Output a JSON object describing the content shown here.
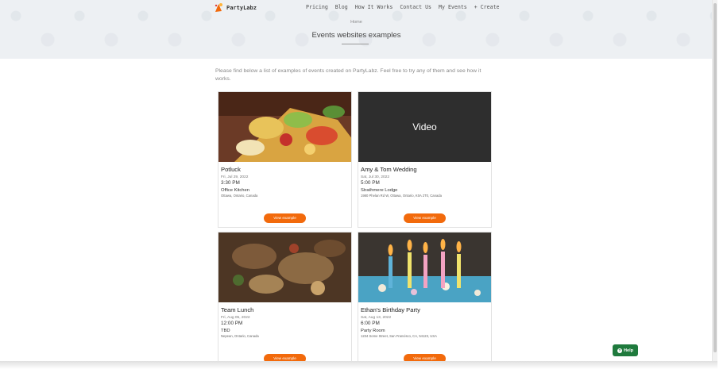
{
  "header": {
    "logo_text": "PartyLabz",
    "nav": [
      "Pricing",
      "Blog",
      "How It Works",
      "Contact Us",
      "My Events",
      "+ Create"
    ]
  },
  "breadcrumb": "Home",
  "page_title": "Events websites examples",
  "intro": "Please find below a list of examples of events created on PartyLabz. Feel free to try any of them and see how it works.",
  "cards": [
    {
      "name": "Potluck",
      "date": "Fri, Jul 29, 2022",
      "time": "3:30 PM",
      "venue": "Office Kitchen",
      "address": "Ottawa, Ontario, Canada",
      "button": "View example",
      "media": "food-platter-photo"
    },
    {
      "name": "Amy & Tom Wedding",
      "date": "Sat, Jul 30, 2022",
      "time": "5:00 PM",
      "venue": "Strathmere Lodge",
      "address": "1980 Phelan Rd W, Ottawa, Ontario, K0A 2T0, Canada",
      "button": "View example",
      "media_label": "Video"
    },
    {
      "name": "Team Lunch",
      "date": "Fri, Aug 05, 2022",
      "time": "12:00 PM",
      "venue": "TBD",
      "address": "Nepean, Ontario, Canada",
      "button": "View example",
      "media": "lunch-table-photo"
    },
    {
      "name": "Ethan's Birthday Party",
      "date": "Sat, Aug 13, 2022",
      "time": "6:00 PM",
      "venue": "Party Room",
      "address": "1234 Some Street, San Francisco, CA, 54123, USA",
      "button": "View example",
      "media": "birthday-candles-photo"
    }
  ],
  "help": {
    "label": "Help",
    "icon": "question-circle-icon"
  },
  "colors": {
    "accent": "#f26a0c",
    "help": "#1f7a3d",
    "video_bg": "#2e2e2e"
  }
}
